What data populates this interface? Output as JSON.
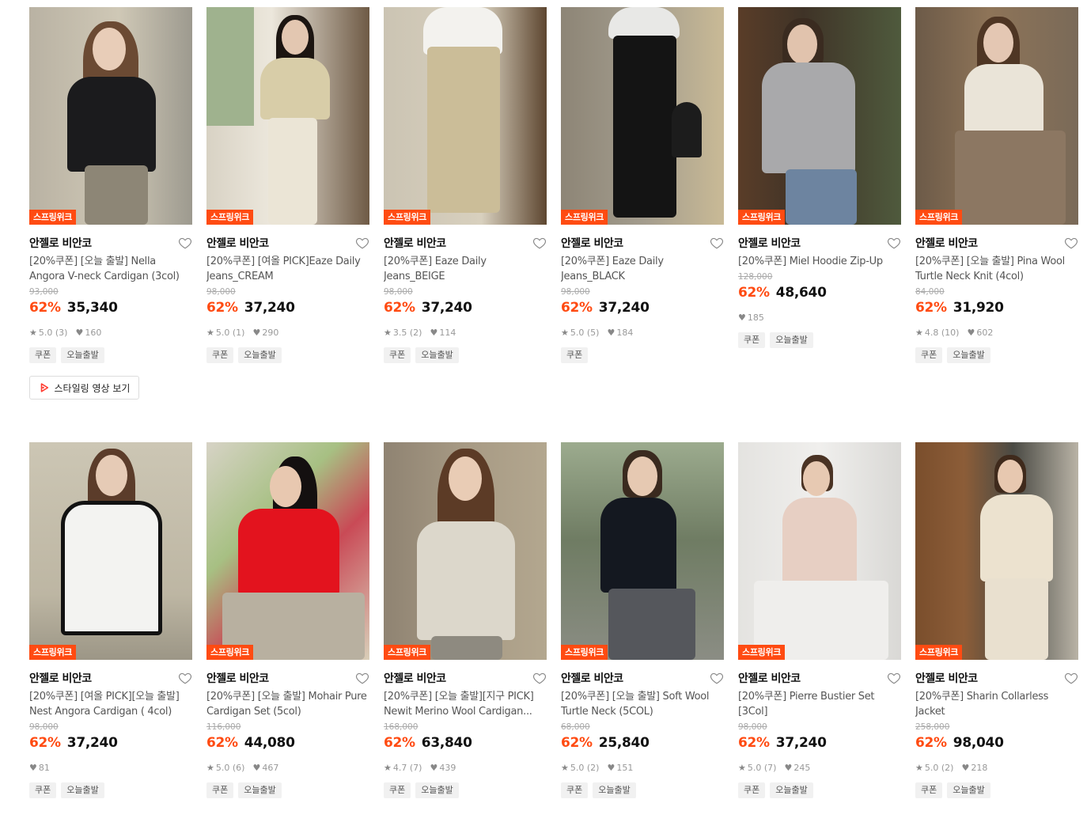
{
  "accent": "#ff4b12",
  "badge_label": "스프링위크",
  "coupon_tag": "쿠폰",
  "ship_tag": "오늘출발",
  "video_button": {
    "label": "스타일링 영상 보기",
    "icon": "play-icon"
  },
  "products": [
    {
      "brand": "안젤로 비안코",
      "name": "[20%쿠폰] [오늘 출발] Nella Angora V-neck Cardigan (3col)",
      "orig": "93,000",
      "discount": "62%",
      "price": "35,340",
      "rating": "5.0 (3)",
      "likes": "160",
      "tags": [
        "쿠폰",
        "오늘출발"
      ]
    },
    {
      "brand": "안젤로 비안코",
      "name": "[20%쿠폰] [여올 PICK]Eaze Daily Jeans_CREAM",
      "orig": "98,000",
      "discount": "62%",
      "price": "37,240",
      "rating": "5.0 (1)",
      "likes": "290",
      "tags": [
        "쿠폰",
        "오늘출발"
      ]
    },
    {
      "brand": "안젤로 비안코",
      "name": "[20%쿠폰] Eaze Daily Jeans_BEIGE",
      "orig": "98,000",
      "discount": "62%",
      "price": "37,240",
      "rating": "3.5 (2)",
      "likes": "114",
      "tags": [
        "쿠폰",
        "오늘출발"
      ]
    },
    {
      "brand": "안젤로 비안코",
      "name": "[20%쿠폰] Eaze Daily Jeans_BLACK",
      "orig": "98,000",
      "discount": "62%",
      "price": "37,240",
      "rating": "5.0 (5)",
      "likes": "184",
      "tags": [
        "쿠폰"
      ]
    },
    {
      "brand": "안젤로 비안코",
      "name": "[20%쿠폰] Miel Hoodie Zip-Up",
      "orig": "128,000",
      "discount": "62%",
      "price": "48,640",
      "rating": "",
      "likes": "185",
      "tags": [
        "쿠폰",
        "오늘출발"
      ]
    },
    {
      "brand": "안젤로 비안코",
      "name": "[20%쿠폰] [오늘 출발] Pina Wool Turtle Neck Knit (4col)",
      "orig": "84,000",
      "discount": "62%",
      "price": "31,920",
      "rating": "4.8 (10)",
      "likes": "602",
      "tags": [
        "쿠폰",
        "오늘출발"
      ]
    },
    {
      "brand": "안젤로 비안코",
      "name": "[20%쿠폰] [여올 PICK][오늘 출발] Nest Angora Cardigan ( 4col)",
      "orig": "98,000",
      "discount": "62%",
      "price": "37,240",
      "rating": "",
      "likes": "81",
      "tags": [
        "쿠폰",
        "오늘출발"
      ]
    },
    {
      "brand": "안젤로 비안코",
      "name": "[20%쿠폰] [오늘 출발] Mohair Pure Cardigan Set (5col)",
      "orig": "116,000",
      "discount": "62%",
      "price": "44,080",
      "rating": "5.0 (6)",
      "likes": "467",
      "tags": [
        "쿠폰",
        "오늘출발"
      ]
    },
    {
      "brand": "안젤로 비안코",
      "name": "[20%쿠폰] [오늘 출발][지구 PICK] Newit Merino Wool Cardigan...",
      "orig": "168,000",
      "discount": "62%",
      "price": "63,840",
      "rating": "4.7 (7)",
      "likes": "439",
      "tags": [
        "쿠폰",
        "오늘출발"
      ]
    },
    {
      "brand": "안젤로 비안코",
      "name": "[20%쿠폰] [오늘 출발] Soft Wool Turtle Neck (5COL)",
      "orig": "68,000",
      "discount": "62%",
      "price": "25,840",
      "rating": "5.0 (2)",
      "likes": "151",
      "tags": [
        "쿠폰",
        "오늘출발"
      ]
    },
    {
      "brand": "안젤로 비안코",
      "name": "[20%쿠폰] Pierre Bustier Set [3Col]",
      "orig": "98,000",
      "discount": "62%",
      "price": "37,240",
      "rating": "5.0 (7)",
      "likes": "245",
      "tags": [
        "쿠폰",
        "오늘출발"
      ]
    },
    {
      "brand": "안젤로 비안코",
      "name": "[20%쿠폰] Sharin Collarless Jacket",
      "orig": "258,000",
      "discount": "62%",
      "price": "98,040",
      "rating": "5.0 (2)",
      "likes": "218",
      "tags": [
        "쿠폰",
        "오늘출발"
      ]
    }
  ]
}
